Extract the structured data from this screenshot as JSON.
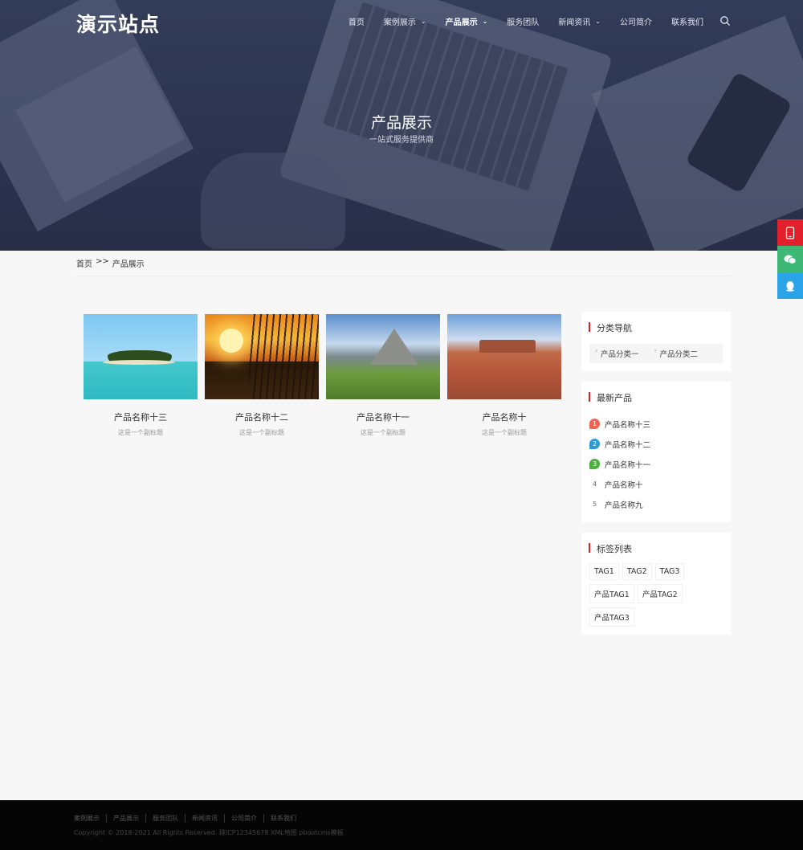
{
  "site": {
    "logo": "演示站点"
  },
  "nav": {
    "items": [
      {
        "label": "首页",
        "dropdown": false,
        "active": false
      },
      {
        "label": "案例展示",
        "dropdown": true,
        "active": false
      },
      {
        "label": "产品展示",
        "dropdown": true,
        "active": true
      },
      {
        "label": "服务团队",
        "dropdown": false,
        "active": false
      },
      {
        "label": "新闻资讯",
        "dropdown": true,
        "active": false
      },
      {
        "label": "公司简介",
        "dropdown": false,
        "active": false
      },
      {
        "label": "联系我们",
        "dropdown": false,
        "active": false
      }
    ],
    "search_icon": "search-icon"
  },
  "hero": {
    "title": "产品展示",
    "subtitle": "一站式服务提供商"
  },
  "breadcrumb": {
    "home": "首页",
    "sep": ">>",
    "current": "产品展示"
  },
  "products": [
    {
      "title": "产品名称十三",
      "subtitle": "这是一个副标题",
      "image": "island"
    },
    {
      "title": "产品名称十二",
      "subtitle": "这是一个副标题",
      "image": "sunset"
    },
    {
      "title": "产品名称十一",
      "subtitle": "这是一个副标题",
      "image": "mountain"
    },
    {
      "title": "产品名称十",
      "subtitle": "这是一个副标题",
      "image": "desert"
    }
  ],
  "sidebar": {
    "categories": {
      "title": "分类导航",
      "items": [
        "产品分类一",
        "产品分类二"
      ]
    },
    "latest": {
      "title": "最新产品",
      "items": [
        {
          "rank": "1",
          "label": "产品名称十三"
        },
        {
          "rank": "2",
          "label": "产品名称十二"
        },
        {
          "rank": "3",
          "label": "产品名称十一"
        },
        {
          "rank": "4",
          "label": "产品名称十"
        },
        {
          "rank": "5",
          "label": "产品名称九"
        }
      ]
    },
    "tags": {
      "title": "标签列表",
      "items": [
        "TAG1",
        "TAG2",
        "TAG3",
        "产品TAG1",
        "产品TAG2",
        "产品TAG3"
      ]
    }
  },
  "side_buttons": {
    "phone": "phone-icon",
    "wechat": "wechat-icon",
    "qq": "qq-icon"
  },
  "footer": {
    "links": [
      "案例展示",
      "产品展示",
      "服务团队",
      "新闻资讯",
      "公司简介",
      "联系我们"
    ],
    "copyright": "Copyright © 2018-2021 All Rights Reserved. 琼ICP12345678 XML地图 pbootcms模板"
  },
  "colors": {
    "accent": "#e2202b",
    "wechat": "#3db975",
    "qq": "#2aa4e9",
    "footer_bg": "#050505"
  }
}
